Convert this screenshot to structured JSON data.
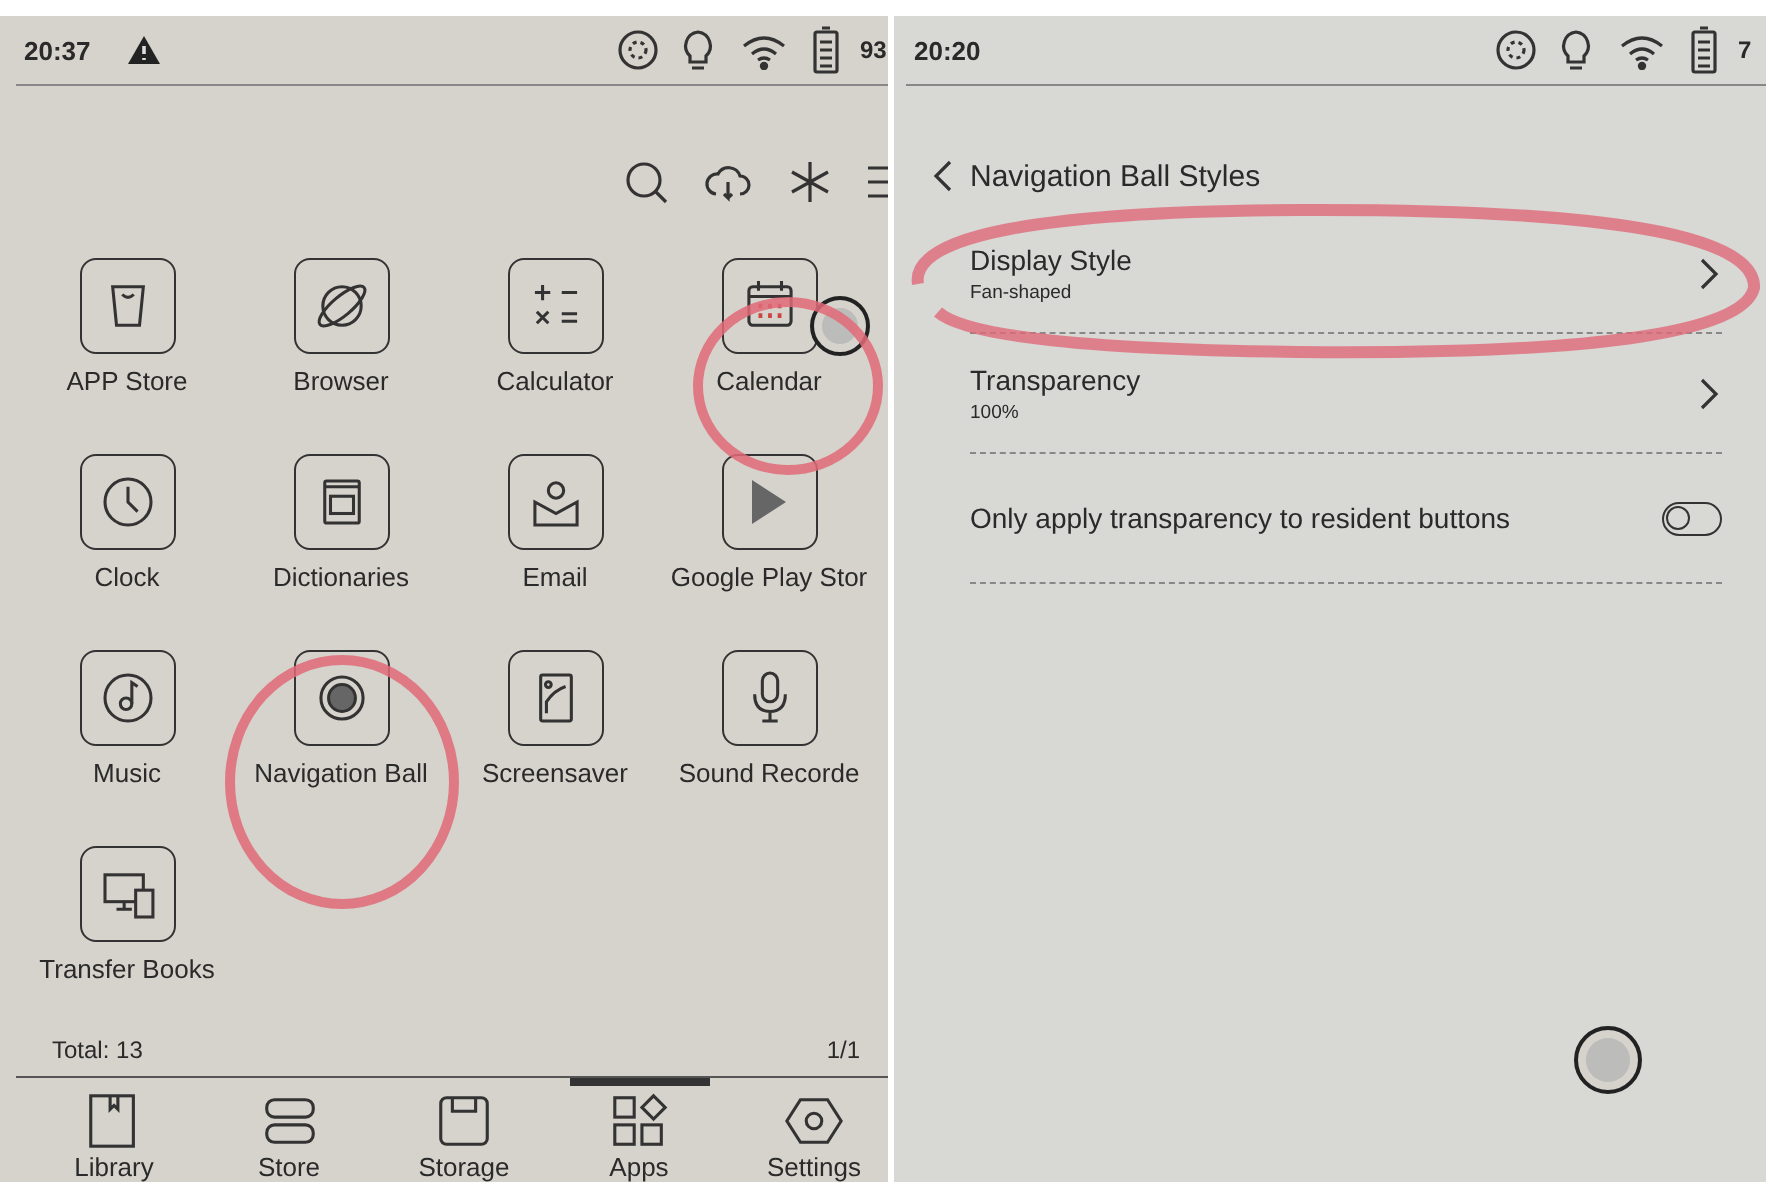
{
  "left_screen": {
    "status_bar": {
      "time": "20:37",
      "battery": "93"
    },
    "apps": [
      {
        "label": "APP Store",
        "kind": "bag"
      },
      {
        "label": "Browser",
        "kind": "planet"
      },
      {
        "label": "Calculator",
        "kind": "calc"
      },
      {
        "label": "Calendar",
        "kind": "calendar"
      },
      {
        "label": "Clock",
        "kind": "clock"
      },
      {
        "label": "Dictionaries",
        "kind": "dict"
      },
      {
        "label": "Email",
        "kind": "mail"
      },
      {
        "label": "Google Play Stor",
        "kind": "play"
      },
      {
        "label": "Music",
        "kind": "music"
      },
      {
        "label": "Navigation Ball",
        "kind": "ball"
      },
      {
        "label": "Screensaver",
        "kind": "tablet"
      },
      {
        "label": "Sound Recorde",
        "kind": "mic"
      },
      {
        "label": "Transfer Books",
        "kind": "devices"
      }
    ],
    "total": "Total: 13",
    "page": "1/1",
    "tabs": [
      {
        "label": "Library",
        "kind": "library",
        "selected": false
      },
      {
        "label": "Store",
        "kind": "store",
        "selected": false
      },
      {
        "label": "Storage",
        "kind": "storage",
        "selected": false
      },
      {
        "label": "Apps",
        "kind": "apps",
        "selected": true
      },
      {
        "label": "Settings",
        "kind": "settings",
        "selected": false
      }
    ]
  },
  "right_screen": {
    "status_bar": {
      "time": "20:20",
      "battery": "7"
    },
    "title": "Navigation Ball Styles",
    "settings": [
      {
        "kind": "link",
        "title": "Display Style",
        "value": "Fan-shaped"
      },
      {
        "kind": "link",
        "title": "Transparency",
        "value": "100%"
      },
      {
        "kind": "toggle",
        "title": "Only apply transparency to resident buttons",
        "on": false
      }
    ]
  }
}
